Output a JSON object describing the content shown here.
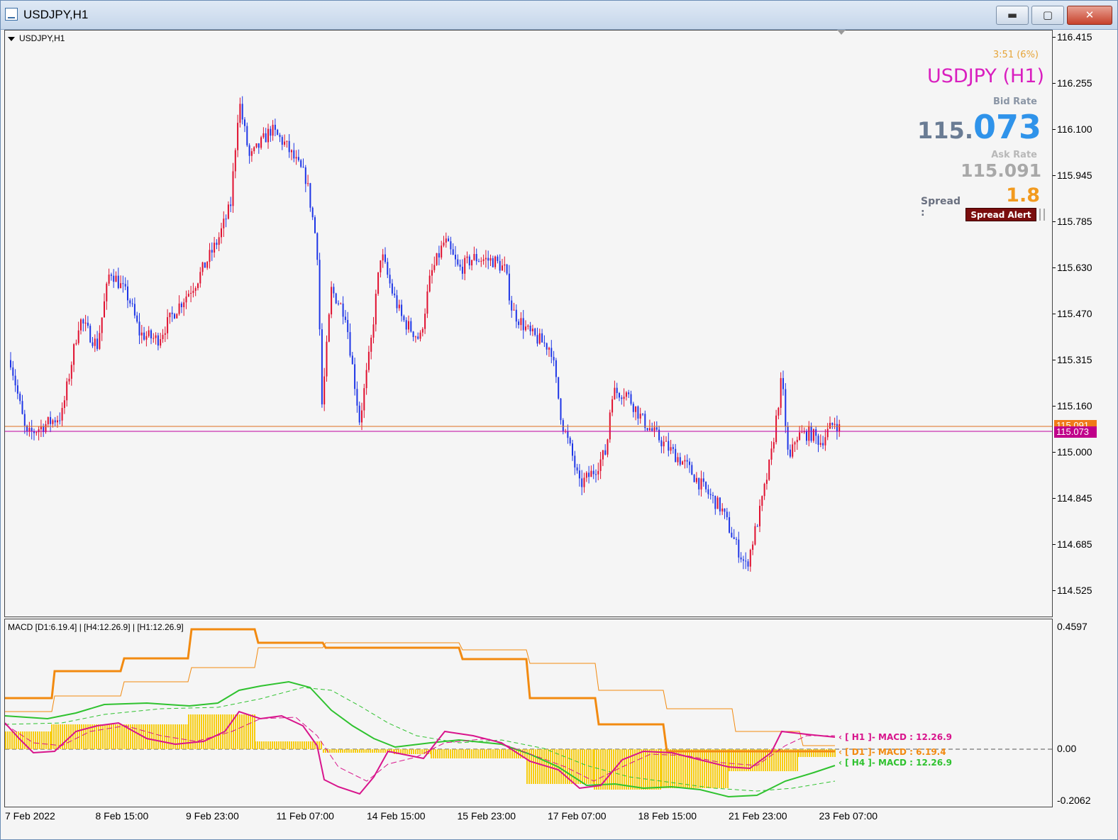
{
  "window": {
    "title": "USDJPY,H1"
  },
  "chart": {
    "symbol_label": "USDJPY,H1",
    "price_ticks": [
      "116.415",
      "116.255",
      "116.100",
      "115.945",
      "115.785",
      "115.630",
      "115.470",
      "115.315",
      "115.160",
      "115.000",
      "114.845",
      "114.685",
      "114.525"
    ],
    "time_ticks": [
      "7 Feb 2022",
      "8 Feb 15:00",
      "9 Feb 23:00",
      "11 Feb 07:00",
      "14 Feb 15:00",
      "15 Feb 23:00",
      "17 Feb 07:00",
      "18 Feb 15:00",
      "21 Feb 23:00",
      "23 Feb 07:00"
    ],
    "ask_tag": "115.091",
    "bid_tag": "115.073",
    "colors": {
      "bull": "#e0102f",
      "bear": "#1d35e6",
      "ask_line": "#e07020",
      "bid_line": "#c000a0"
    }
  },
  "info_panel": {
    "timer": "3:51 (6%)",
    "symbol": "USDJPY (H1)",
    "bid_label": "Bid Rate",
    "bid_int": "115.",
    "bid_frac": "073",
    "ask_label": "Ask Rate",
    "ask_value": "115.091",
    "spread_label": "Spread :",
    "spread_value": "1.8",
    "spread_alert": "Spread Alert"
  },
  "macd": {
    "title": "MACD [D1:6.19.4] | [H4:12.26.9] | [H1:12.26.9]",
    "scale": [
      "0.4597",
      "0.00",
      "-0.2062"
    ],
    "legend": [
      {
        "text": "[ H1 ]- MACD : 12.26.9",
        "color": "#d8148c"
      },
      {
        "text": "[ D1 ]- MACD : 6.19.4",
        "color": "#f28a10"
      },
      {
        "text": "[ H4 ]- MACD : 12.26.9",
        "color": "#2fc22f"
      }
    ]
  }
}
